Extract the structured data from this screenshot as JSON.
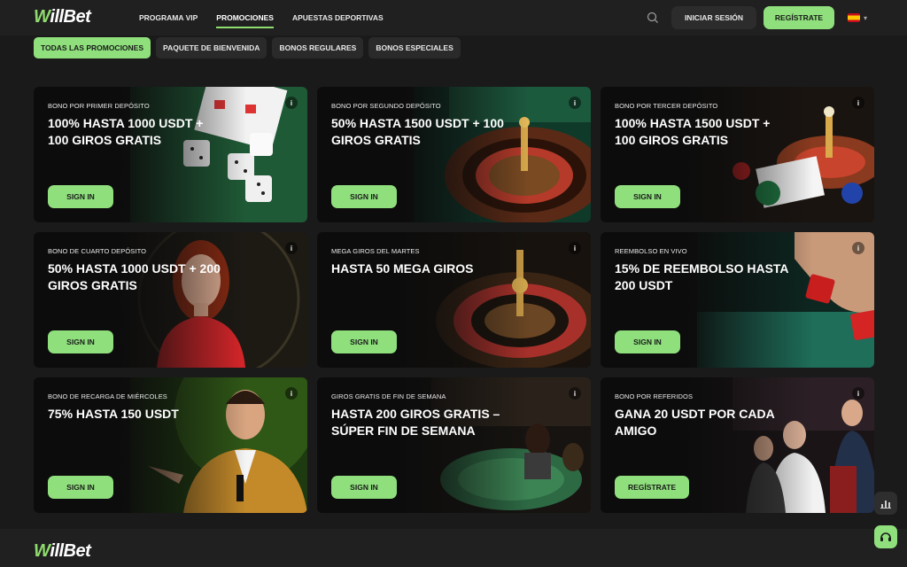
{
  "header": {
    "logo_mark": "W",
    "logo_rest": "illBet",
    "nav": [
      {
        "label": "Programa VIP"
      },
      {
        "label": "Promociones"
      },
      {
        "label": "Apuestas deportivas"
      }
    ],
    "login_label": "Iniciar sesión",
    "register_label": "Regístrate",
    "language_icon": "spain-flag-icon"
  },
  "filters": [
    {
      "label": "Todas las promociones"
    },
    {
      "label": "Paquete de bienvenida"
    },
    {
      "label": "Bonos regulares"
    },
    {
      "label": "Bonos especiales"
    }
  ],
  "cards": [
    {
      "subtitle": "Bono por primer depósito",
      "title": "100% hasta 1000 USDT + 100 giros gratis",
      "cta": "Sign in",
      "info": "i"
    },
    {
      "subtitle": "Bono por segundo depósito",
      "title": "50% hasta 1500 USDT + 100 giros gratis",
      "cta": "Sign in",
      "info": "i"
    },
    {
      "subtitle": "Bono por tercer depósito",
      "title": "100% hasta 1500 USDT + 100 giros gratis",
      "cta": "Sign in",
      "info": "i"
    },
    {
      "subtitle": "Bono de cuarto depósito",
      "title": "50% hasta 1000 USDT + 200 giros gratis",
      "cta": "Sign in",
      "info": "i"
    },
    {
      "subtitle": "Mega giros del martes",
      "title": "Hasta 50 mega giros",
      "cta": "Sign in",
      "info": "i"
    },
    {
      "subtitle": "Reembolso en vivo",
      "title": "15% de reembolso hasta 200 USDT",
      "cta": "Sign in",
      "info": "i"
    },
    {
      "subtitle": "Bono de recarga de miércoles",
      "title": "75% hasta 150 USDT",
      "cta": "Sign in",
      "info": "i"
    },
    {
      "subtitle": "Giros gratis de fin de semana",
      "title": "Hasta 200 giros gratis – Súper fin de semana",
      "cta": "Sign in",
      "info": "i"
    },
    {
      "subtitle": "Bono por referidos",
      "title": "Gana 20 USDT por cada amigo",
      "cta": "Regístrate",
      "info": "i"
    }
  ],
  "footer": {
    "logo_mark": "W",
    "logo_rest": "illBet"
  },
  "colors": {
    "accent": "#8fe07d",
    "background": "#1a1a1a",
    "bar": "#202020"
  }
}
